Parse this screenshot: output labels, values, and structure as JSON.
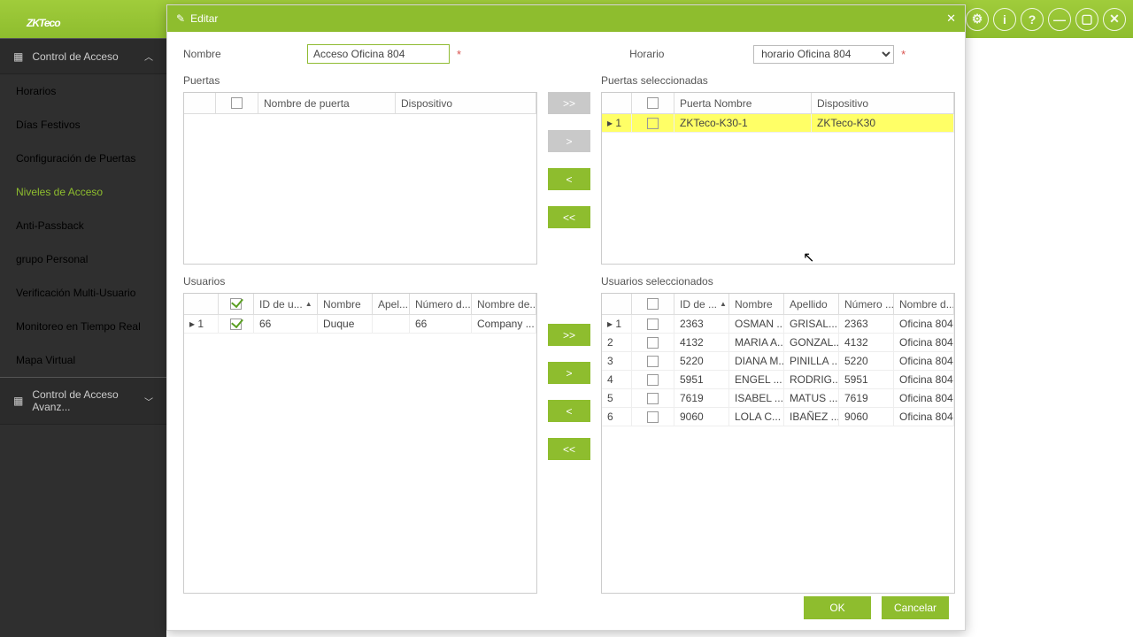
{
  "brand": "ZKTeco",
  "sidebar": {
    "head1": "Control de Acceso",
    "items": [
      "Horarios",
      "Días Festivos",
      "Configuración de Puertas",
      "Niveles de Acceso",
      "Anti-Passback",
      "grupo Personal",
      "Verificación Multi-Usuario",
      "Monitoreo en Tiempo Real",
      "Mapa Virtual"
    ],
    "head2": "Control de Acceso Avanz..."
  },
  "dlg": {
    "title": "Editar",
    "nombre_lbl": "Nombre",
    "nombre_val": "Acceso Oficina 804",
    "horario_lbl": "Horario",
    "horario_val": "horario Oficina 804",
    "puertas_lbl": "Puertas",
    "puertas_sel_lbl": "Puertas seleccionadas",
    "usuarios_lbl": "Usuarios",
    "usuarios_sel_lbl": "Usuarios seleccionados",
    "btns": {
      "aa": ">>",
      "a": ">",
      "r": "<",
      "rr": "<<"
    },
    "ok": "OK",
    "cancel": "Cancelar"
  },
  "pcols": {
    "c1": "Nombre de puerta",
    "c2": "Dispositivo",
    "c3": "Puerta Nombre"
  },
  "psel": [
    {
      "idx": "1",
      "nombre": "ZKTeco-K30-1",
      "disp": "ZKTeco-K30"
    }
  ],
  "ucols": {
    "id": "ID de u...",
    "nom": "Nombre",
    "ape": "Apel...",
    "num": "Número d...",
    "dep": "Nombre de...",
    "id2": "ID de ...",
    "ape2": "Apellido",
    "num2": "Número ...",
    "dep2": "Nombre d..."
  },
  "uleft": [
    {
      "idx": "1",
      "id": "66",
      "nom": "Duque",
      "ape": "",
      "num": "66",
      "dep": "Company ..."
    }
  ],
  "uright": [
    {
      "idx": "1",
      "id": "2363",
      "nom": "OSMAN ...",
      "ape": "GRISAL...",
      "num": "2363",
      "dep": "Oficina 804"
    },
    {
      "idx": "2",
      "id": "4132",
      "nom": "MARIA A...",
      "ape": "GONZAL...",
      "num": "4132",
      "dep": "Oficina 804"
    },
    {
      "idx": "3",
      "id": "5220",
      "nom": "DIANA M...",
      "ape": "PINILLA ...",
      "num": "5220",
      "dep": "Oficina 804"
    },
    {
      "idx": "4",
      "id": "5951",
      "nom": "ENGEL ...",
      "ape": "RODRIG...",
      "num": "5951",
      "dep": "Oficina 804"
    },
    {
      "idx": "5",
      "id": "7619",
      "nom": "ISABEL ...",
      "ape": "MATUS ...",
      "num": "7619",
      "dep": "Oficina 804"
    },
    {
      "idx": "6",
      "id": "9060",
      "nom": "LOLA C...",
      "ape": "IBAÑEZ ...",
      "num": "9060",
      "dep": "Oficina 804"
    }
  ]
}
